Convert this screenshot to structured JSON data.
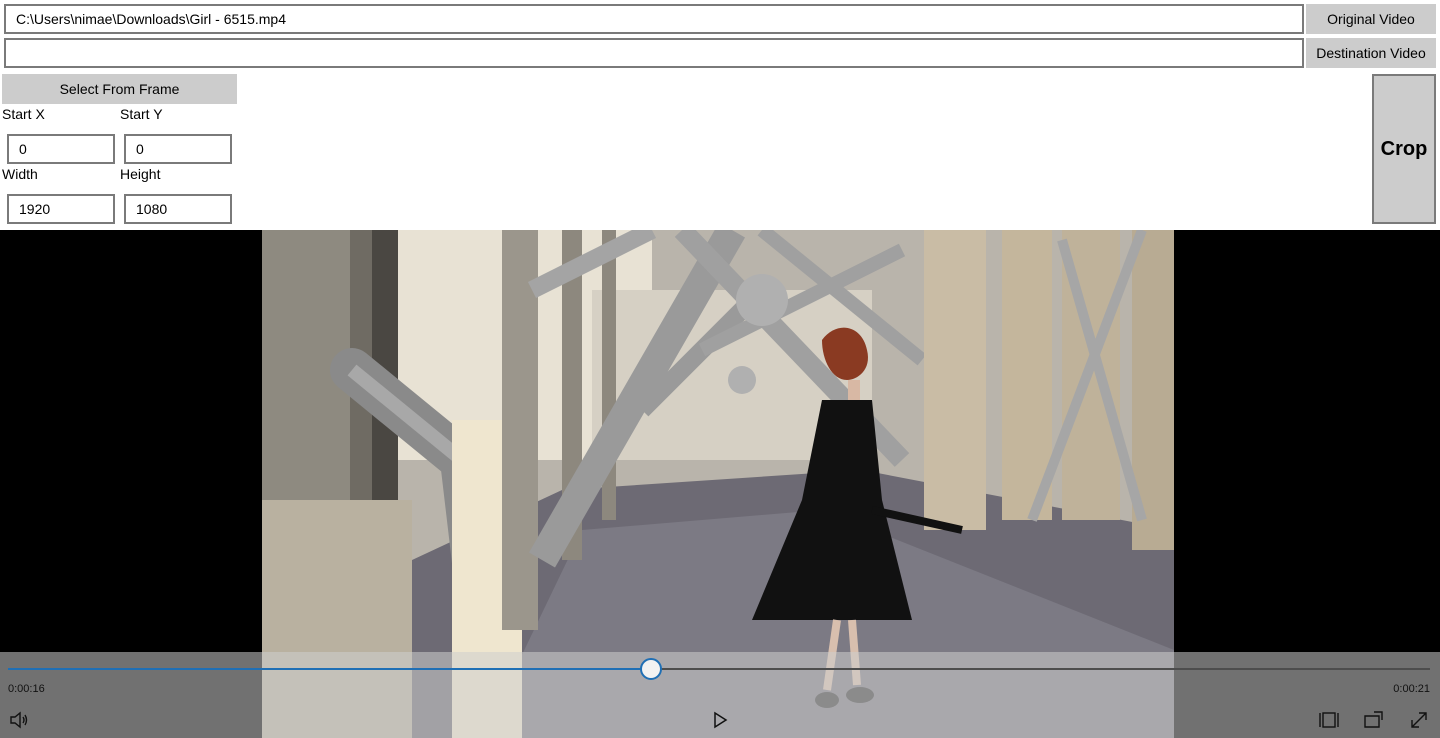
{
  "source": {
    "path": "C:\\Users\\nimae\\Downloads\\Girl - 6515.mp4",
    "button": "Original Video"
  },
  "destination": {
    "path": "",
    "button": "Destination Video"
  },
  "crop_panel": {
    "select_button": "Select From Frame",
    "start_x_label": "Start X",
    "start_y_label": "Start Y",
    "width_label": "Width",
    "height_label": "Height",
    "start_x": "0",
    "start_y": "0",
    "width": "1920",
    "height": "1080"
  },
  "crop_button": "Crop",
  "player": {
    "elapsed": "0:00:16",
    "remaining": "0:00:21",
    "progress": 0.452,
    "icons": [
      "volume-icon",
      "play-icon",
      "aspect-ratio-icon",
      "cast-icon",
      "fullscreen-icon"
    ]
  },
  "colors": {
    "accent": "#1f6fb5",
    "button_bg": "#cccccc",
    "border": "#7a7a7a"
  }
}
